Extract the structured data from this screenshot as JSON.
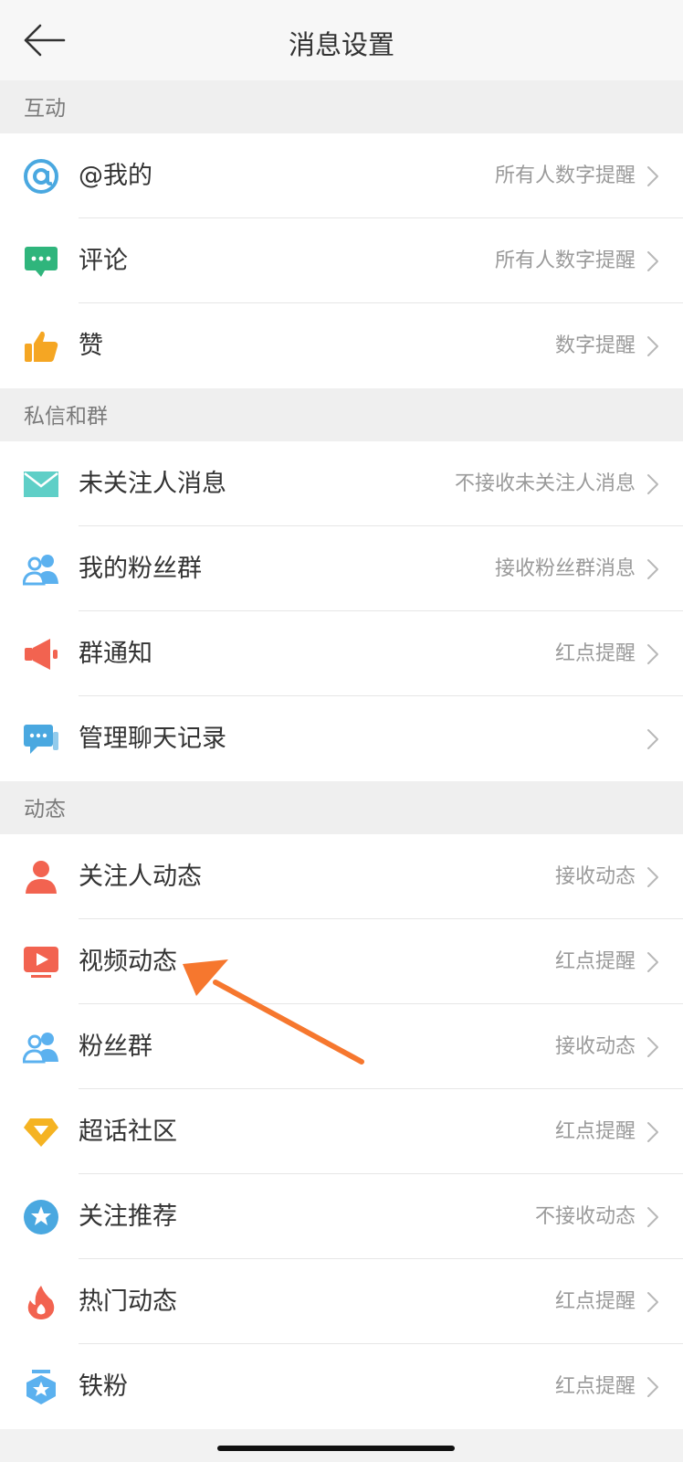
{
  "header": {
    "title": "消息设置"
  },
  "sections": [
    {
      "title": "互动",
      "items": [
        {
          "label": "@我的",
          "value": "所有人数字提醒",
          "icon": "at-icon"
        },
        {
          "label": "评论",
          "value": "所有人数字提醒",
          "icon": "comment-icon"
        },
        {
          "label": "赞",
          "value": "数字提醒",
          "icon": "thumbs-up-icon"
        }
      ]
    },
    {
      "title": "私信和群",
      "items": [
        {
          "label": "未关注人消息",
          "value": "不接收未关注人消息",
          "icon": "envelope-icon"
        },
        {
          "label": "我的粉丝群",
          "value": "接收粉丝群消息",
          "icon": "group-icon"
        },
        {
          "label": "群通知",
          "value": "红点提醒",
          "icon": "megaphone-icon"
        },
        {
          "label": "管理聊天记录",
          "value": "",
          "icon": "chat-manage-icon"
        }
      ]
    },
    {
      "title": "动态",
      "items": [
        {
          "label": "关注人动态",
          "value": "接收动态",
          "icon": "person-icon"
        },
        {
          "label": "视频动态",
          "value": "红点提醒",
          "icon": "video-play-icon"
        },
        {
          "label": "粉丝群",
          "value": "接收动态",
          "icon": "group-icon"
        },
        {
          "label": "超话社区",
          "value": "红点提醒",
          "icon": "diamond-icon"
        },
        {
          "label": "关注推荐",
          "value": "不接收动态",
          "icon": "star-badge-icon"
        },
        {
          "label": "热门动态",
          "value": "红点提醒",
          "icon": "flame-icon"
        },
        {
          "label": "铁粉",
          "value": "红点提醒",
          "icon": "shield-star-icon"
        }
      ]
    }
  ],
  "colors": {
    "at": "#4aa8e0",
    "comment": "#2fb57c",
    "thumb": "#f5a623",
    "envelope": "#5fcfc7",
    "group": "#5bb1ef",
    "megaphone": "#f26350",
    "chat": "#4aa8e0",
    "person": "#f26350",
    "video": "#f26350",
    "diamond": "#f5b322",
    "starbadge": "#4aa8e0",
    "flame": "#f26350",
    "shield": "#5bb1ef",
    "annotation_arrow": "#f6772e"
  }
}
